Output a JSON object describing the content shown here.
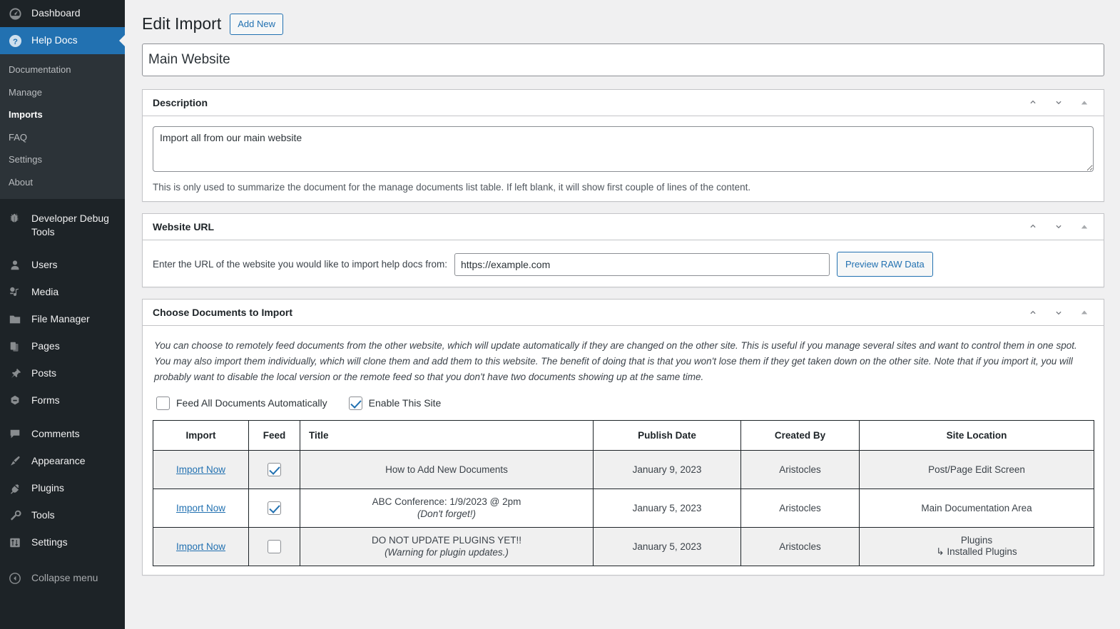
{
  "sidebar": {
    "items": [
      {
        "label": "Dashboard",
        "icon": "dashboard-icon",
        "current": false
      },
      {
        "label": "Help Docs",
        "icon": "help-icon",
        "current": true
      }
    ],
    "submenu": [
      {
        "label": "Documentation",
        "active": false
      },
      {
        "label": "Manage",
        "active": false
      },
      {
        "label": "Imports",
        "active": true
      },
      {
        "label": "FAQ",
        "active": false
      },
      {
        "label": "Settings",
        "active": false
      },
      {
        "label": "About",
        "active": false
      }
    ],
    "items2": [
      {
        "label": "Developer Debug Tools",
        "icon": "bug-icon"
      },
      {
        "label": "Users",
        "icon": "user-icon"
      },
      {
        "label": "Media",
        "icon": "media-icon"
      },
      {
        "label": "File Manager",
        "icon": "folder-icon"
      },
      {
        "label": "Pages",
        "icon": "pages-icon"
      },
      {
        "label": "Posts",
        "icon": "pin-icon"
      },
      {
        "label": "Forms",
        "icon": "forms-icon"
      },
      {
        "label": "Comments",
        "icon": "comment-icon"
      },
      {
        "label": "Appearance",
        "icon": "paintbrush-icon"
      },
      {
        "label": "Plugins",
        "icon": "plug-icon"
      },
      {
        "label": "Tools",
        "icon": "wrench-icon"
      },
      {
        "label": "Settings",
        "icon": "sliders-icon"
      }
    ],
    "collapse": {
      "label": "Collapse menu",
      "icon": "collapse-arrow-icon"
    }
  },
  "header": {
    "title": "Edit Import",
    "add_new_label": "Add New"
  },
  "title_field": {
    "value": "Main Website"
  },
  "panels": {
    "description": {
      "heading": "Description",
      "textarea_value": "Import all from our main website",
      "help": "This is only used to summarize the document for the manage documents list table. If left blank, it will show first couple of lines of the content."
    },
    "website_url": {
      "heading": "Website URL",
      "label": "Enter the URL of the website you would like to import help docs from:",
      "input_value": "https://example.com",
      "preview_button": "Preview RAW Data"
    },
    "choose_documents": {
      "heading": "Choose Documents to Import",
      "intro": "You can choose to remotely feed documents from the other website, which will update automatically if they are changed on the other site. This is useful if you manage several sites and want to control them in one spot. You may also import them individually, which will clone them and add them to this website. The benefit of doing that is that you won't lose them if they get taken down on the other site. Note that if you import it, you will probably want to disable the local version or the remote feed so that you don't have two documents showing up at the same time.",
      "checkboxes": [
        {
          "label": "Feed All Documents Automatically",
          "checked": false
        },
        {
          "label": "Enable This Site",
          "checked": true
        }
      ],
      "table": {
        "columns": [
          "Import",
          "Feed",
          "Title",
          "Publish Date",
          "Created By",
          "Site Location"
        ],
        "rows": [
          {
            "import_label": "Import Now",
            "feed_checked": true,
            "title": "How to Add New Documents",
            "title_sub": "",
            "publish_date": "January 9, 2023",
            "created_by": "Aristocles",
            "site_location": "Post/Page Edit Screen",
            "site_location_sub": ""
          },
          {
            "import_label": "Import Now",
            "feed_checked": true,
            "title": "ABC Conference: 1/9/2023 @ 2pm",
            "title_sub": "(Don't forget!)",
            "publish_date": "January 5, 2023",
            "created_by": "Aristocles",
            "site_location": "Main Documentation Area",
            "site_location_sub": ""
          },
          {
            "import_label": "Import Now",
            "feed_checked": false,
            "title": "DO NOT UPDATE PLUGINS YET!!",
            "title_sub": "(Warning for plugin updates.)",
            "publish_date": "January 5, 2023",
            "created_by": "Aristocles",
            "site_location": "Plugins",
            "site_location_sub": "↳ Installed Plugins"
          }
        ]
      }
    }
  },
  "colors": {
    "accent": "#2271b1",
    "sidebar_bg": "#1d2327",
    "submenu_bg": "#2c3338",
    "page_bg": "#f0f0f1"
  }
}
